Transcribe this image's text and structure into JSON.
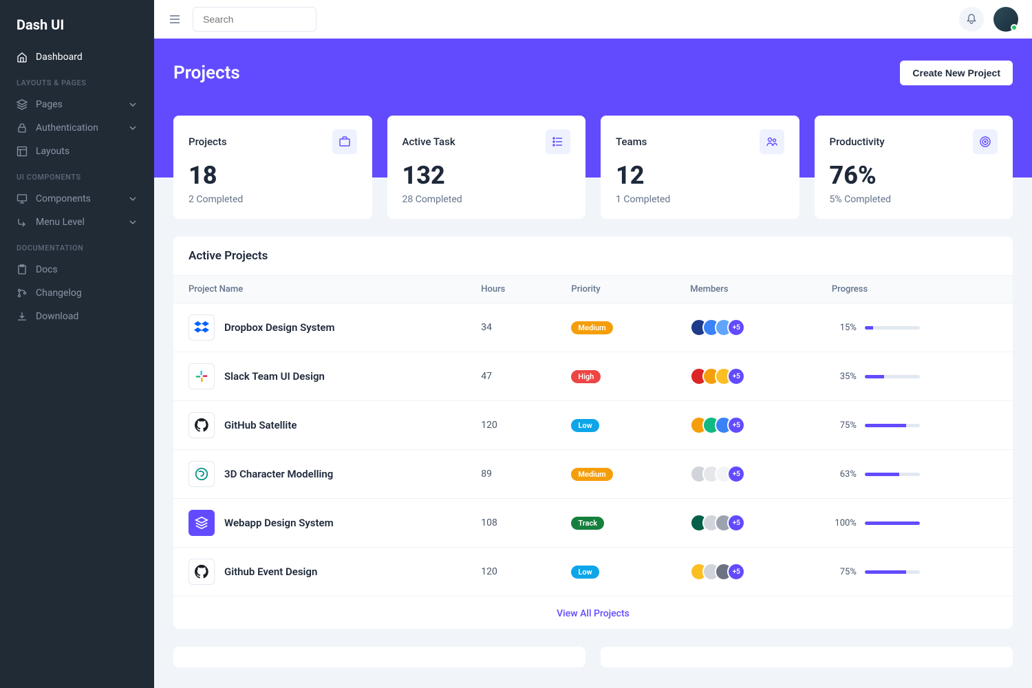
{
  "brand": "Dash UI",
  "search": {
    "placeholder": "Search"
  },
  "sidebar": {
    "dashboard": "Dashboard",
    "sections": {
      "layouts": "LAYOUTS & PAGES",
      "components": "UI COMPONENTS",
      "docs": "DOCUMENTATION"
    },
    "items": {
      "pages": "Pages",
      "auth": "Authentication",
      "layouts": "Layouts",
      "components": "Components",
      "menulevel": "Menu Level",
      "docs": "Docs",
      "changelog": "Changelog",
      "download": "Download"
    }
  },
  "hero": {
    "title": "Projects",
    "cta": "Create New Project"
  },
  "stats": [
    {
      "label": "Projects",
      "value": "18",
      "sub": "2 Completed"
    },
    {
      "label": "Active Task",
      "value": "132",
      "sub": "28 Completed"
    },
    {
      "label": "Teams",
      "value": "12",
      "sub": "1 Completed"
    },
    {
      "label": "Productivity",
      "value": "76%",
      "sub": "5% Completed"
    }
  ],
  "table": {
    "title": "Active Projects",
    "headers": {
      "name": "Project Name",
      "hours": "Hours",
      "priority": "Priority",
      "members": "Members",
      "progress": "Progress"
    },
    "more_badge": "+5",
    "footer": "View All Projects",
    "rows": [
      {
        "name": "Dropbox Design System",
        "hours": "34",
        "priority_label": "Medium",
        "priority_class": "medium",
        "progress_label": "15%",
        "progress_pct": 15,
        "logo": "dropbox"
      },
      {
        "name": "Slack Team UI Design",
        "hours": "47",
        "priority_label": "High",
        "priority_class": "high",
        "progress_label": "35%",
        "progress_pct": 35,
        "logo": "slack"
      },
      {
        "name": "GitHub Satellite",
        "hours": "120",
        "priority_label": "Low",
        "priority_class": "low",
        "progress_label": "75%",
        "progress_pct": 75,
        "logo": "github"
      },
      {
        "name": "3D Character Modelling",
        "hours": "89",
        "priority_label": "Medium",
        "priority_class": "medium",
        "progress_label": "63%",
        "progress_pct": 63,
        "logo": "3d"
      },
      {
        "name": "Webapp Design System",
        "hours": "108",
        "priority_label": "Track",
        "priority_class": "track",
        "progress_label": "100%",
        "progress_pct": 100,
        "logo": "layers"
      },
      {
        "name": "Github Event Design",
        "hours": "120",
        "priority_label": "Low",
        "priority_class": "low",
        "progress_label": "75%",
        "progress_pct": 75,
        "logo": "github"
      }
    ]
  },
  "avatar_colors": [
    [
      "#1e3a8a",
      "#3b82f6",
      "#60a5fa"
    ],
    [
      "#dc2626",
      "#f59e0b",
      "#fbbf24"
    ],
    [
      "#f59e0b",
      "#10b981",
      "#3b82f6"
    ],
    [
      "#d1d5db",
      "#e5e7eb",
      "#f3f4f6"
    ],
    [
      "#065f46",
      "#d1d5db",
      "#9ca3af"
    ],
    [
      "#fbbf24",
      "#d1d5db",
      "#6b7280"
    ]
  ]
}
